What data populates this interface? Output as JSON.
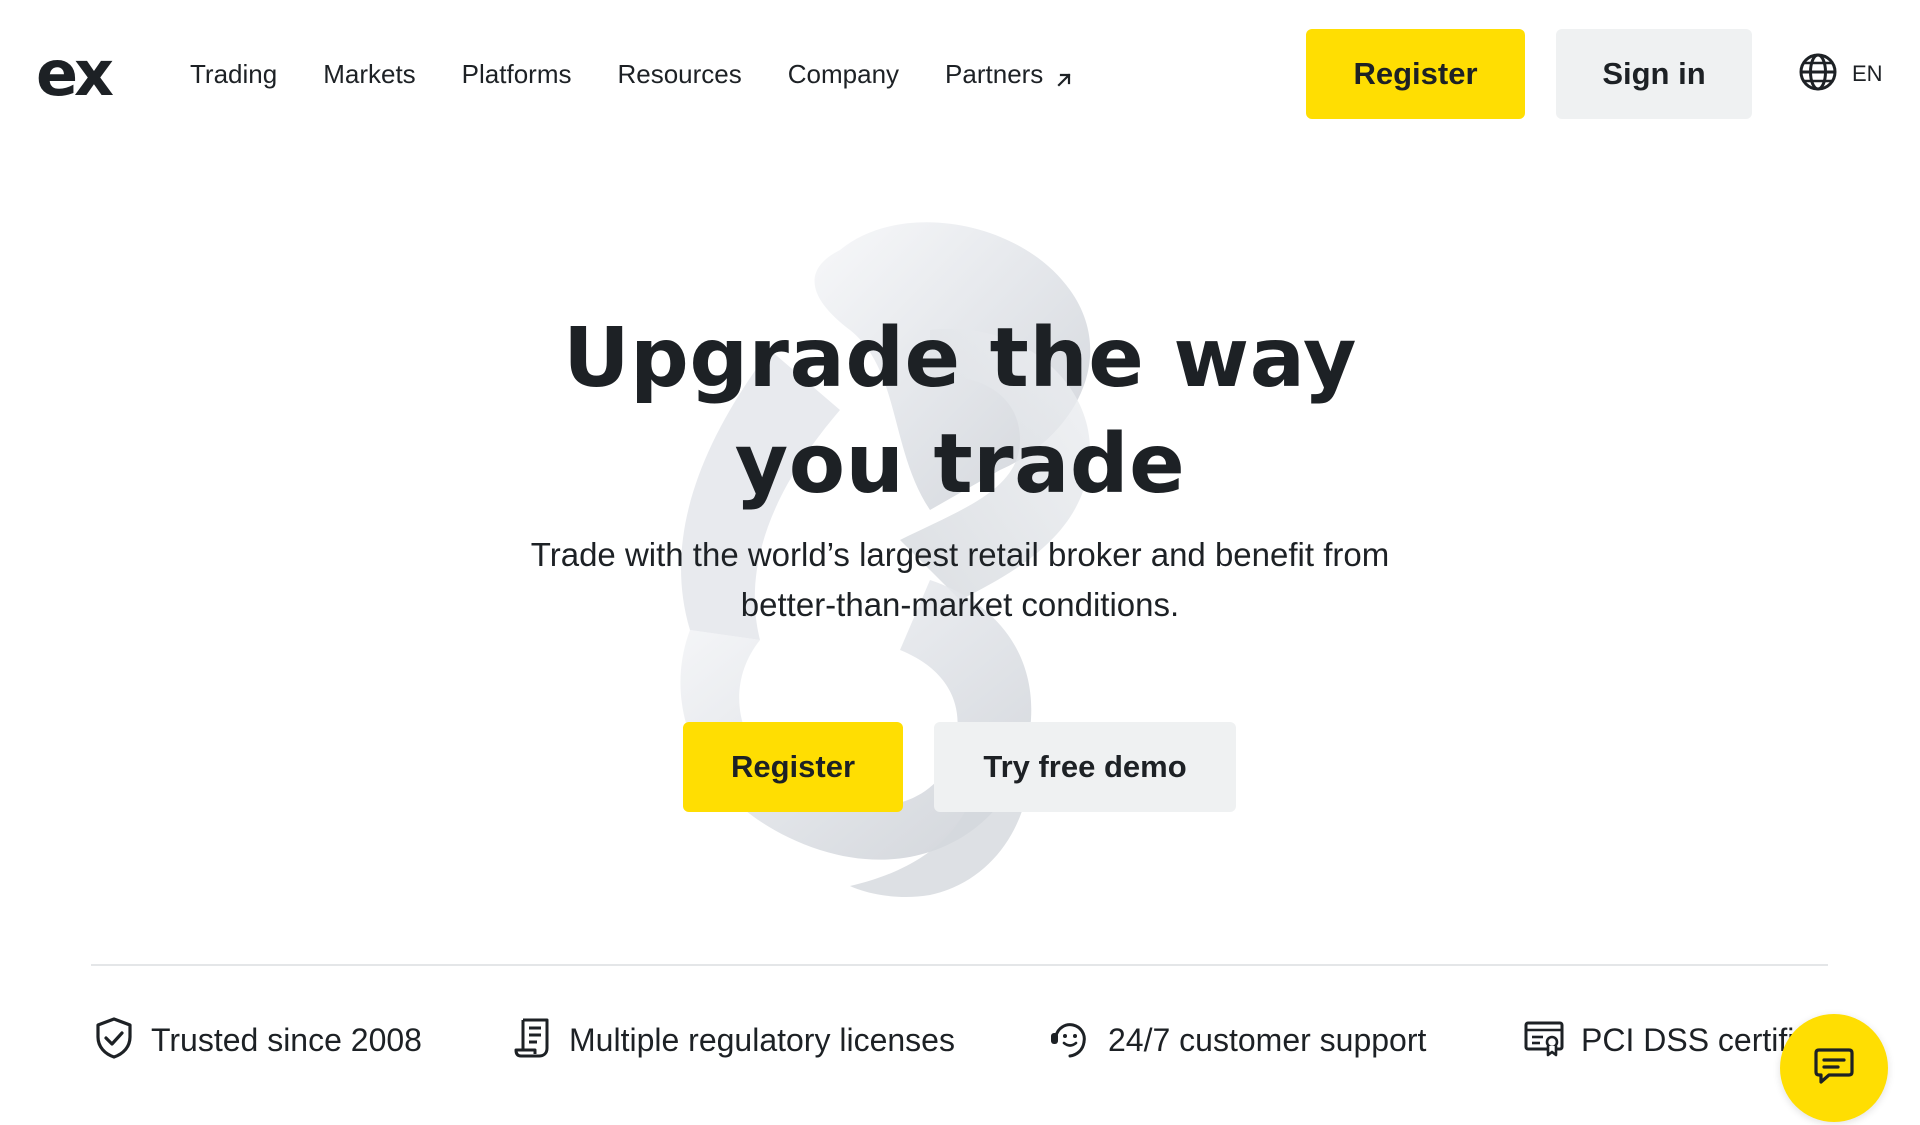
{
  "brand": {
    "logo_text": "ex"
  },
  "nav": {
    "items": [
      {
        "label": "Trading"
      },
      {
        "label": "Markets"
      },
      {
        "label": "Platforms"
      },
      {
        "label": "Resources"
      },
      {
        "label": "Company"
      },
      {
        "label": "Partners"
      }
    ]
  },
  "header": {
    "register_label": "Register",
    "signin_label": "Sign in",
    "language": "EN"
  },
  "hero": {
    "title_line1": "Upgrade the way",
    "title_line2": "you trade",
    "subtitle_line1": "Trade with the world’s largest retail broker and benefit from",
    "subtitle_line2": "better-than-market conditions.",
    "register_label": "Register",
    "demo_label": "Try free demo"
  },
  "features": [
    {
      "label": "Trusted since 2008",
      "icon": "shield-check-icon"
    },
    {
      "label": "Multiple regulatory licenses",
      "icon": "document-license-icon"
    },
    {
      "label": "24/7 customer support",
      "icon": "support-headset-icon"
    },
    {
      "label": "PCI DSS certifi",
      "icon": "certificate-icon"
    }
  ],
  "colors": {
    "accent_yellow": "#ffde02",
    "button_grey": "#eff1f2",
    "text_dark": "#1d2125"
  },
  "chat": {
    "icon": "chat-bubble-icon"
  }
}
